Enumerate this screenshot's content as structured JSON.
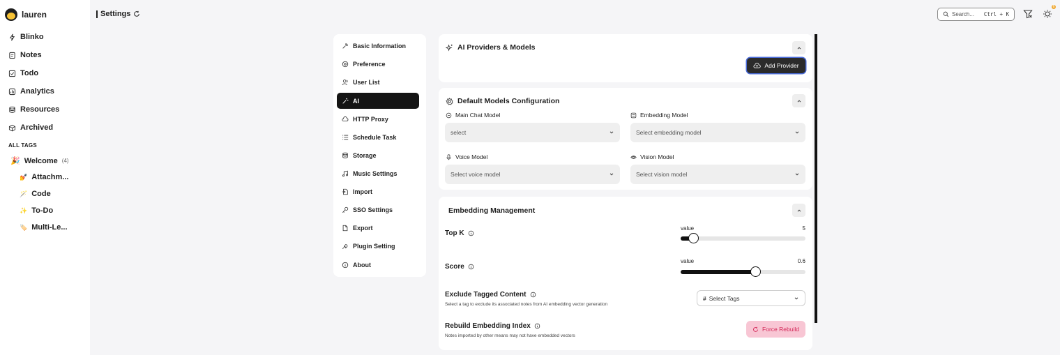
{
  "user": {
    "name": "lauren"
  },
  "nav": [
    {
      "label": "Blinko",
      "icon": "bolt-icon"
    },
    {
      "label": "Notes",
      "icon": "notes-icon"
    },
    {
      "label": "Todo",
      "icon": "todo-icon"
    },
    {
      "label": "Analytics",
      "icon": "analytics-icon"
    },
    {
      "label": "Resources",
      "icon": "database-icon"
    },
    {
      "label": "Archived",
      "icon": "archive-box-icon"
    }
  ],
  "tags": {
    "heading": "ALL TAGS",
    "items": [
      {
        "label": "Welcome",
        "count": "(4)",
        "emoji": "🎉"
      },
      {
        "label": "Attachm...",
        "emoji": "💅"
      },
      {
        "label": "Code",
        "emoji": "🪄"
      },
      {
        "label": "To-Do",
        "emoji": "✨"
      },
      {
        "label": "Multi-Le...",
        "emoji": "🏷️"
      }
    ]
  },
  "topbar": {
    "title": "Settings",
    "search_placeholder": "Search...",
    "search_shortcut": "Ctrl + K",
    "notification_count": "6"
  },
  "settings_menu": [
    {
      "label": "Basic Information",
      "icon": "tools-icon",
      "active": false
    },
    {
      "label": "Preference",
      "icon": "preference-icon",
      "active": false
    },
    {
      "label": "User List",
      "icon": "users-icon",
      "active": false
    },
    {
      "label": "AI",
      "icon": "magic-wand-icon",
      "active": true
    },
    {
      "label": "HTTP Proxy",
      "icon": "cloud-icon",
      "active": false
    },
    {
      "label": "Schedule Task",
      "icon": "list-icon",
      "active": false
    },
    {
      "label": "Storage",
      "icon": "storage-icon",
      "active": false
    },
    {
      "label": "Music Settings",
      "icon": "music-icon",
      "active": false
    },
    {
      "label": "Import",
      "icon": "import-icon",
      "active": false
    },
    {
      "label": "SSO Settings",
      "icon": "key-icon",
      "active": false
    },
    {
      "label": "Export",
      "icon": "export-icon",
      "active": false
    },
    {
      "label": "Plugin Setting",
      "icon": "plugin-icon",
      "active": false
    },
    {
      "label": "About",
      "icon": "info-icon",
      "active": false
    }
  ],
  "providers": {
    "title": "AI Providers & Models",
    "add_button": "Add Provider"
  },
  "default_models": {
    "title": "Default Models Configuration",
    "main_chat": {
      "label": "Main Chat Model",
      "value": "select"
    },
    "embedding": {
      "label": "Embedding Model",
      "value": "Select embedding model"
    },
    "voice": {
      "label": "Voice Model",
      "value": "Select voice model"
    },
    "vision": {
      "label": "Vision Model",
      "value": "Select vision model"
    }
  },
  "embedding": {
    "title": "Embedding Management",
    "top_k": {
      "label": "Top K",
      "value_label": "value",
      "value": "5",
      "min": 0,
      "max": 50,
      "current": 5
    },
    "score": {
      "label": "Score",
      "value_label": "value",
      "value": "0.6",
      "min": 0,
      "max": 1,
      "current": 0.6
    },
    "exclude": {
      "label": "Exclude Tagged Content",
      "description": "Select a tag to exclude its associated notes from AI embedding vector generation",
      "select_placeholder": "Select Tags",
      "hash": "#"
    },
    "rebuild": {
      "label": "Rebuild Embedding Index",
      "description": "Notes imported by other means may not have embedded vectors",
      "button": "Force Rebuild"
    }
  }
}
